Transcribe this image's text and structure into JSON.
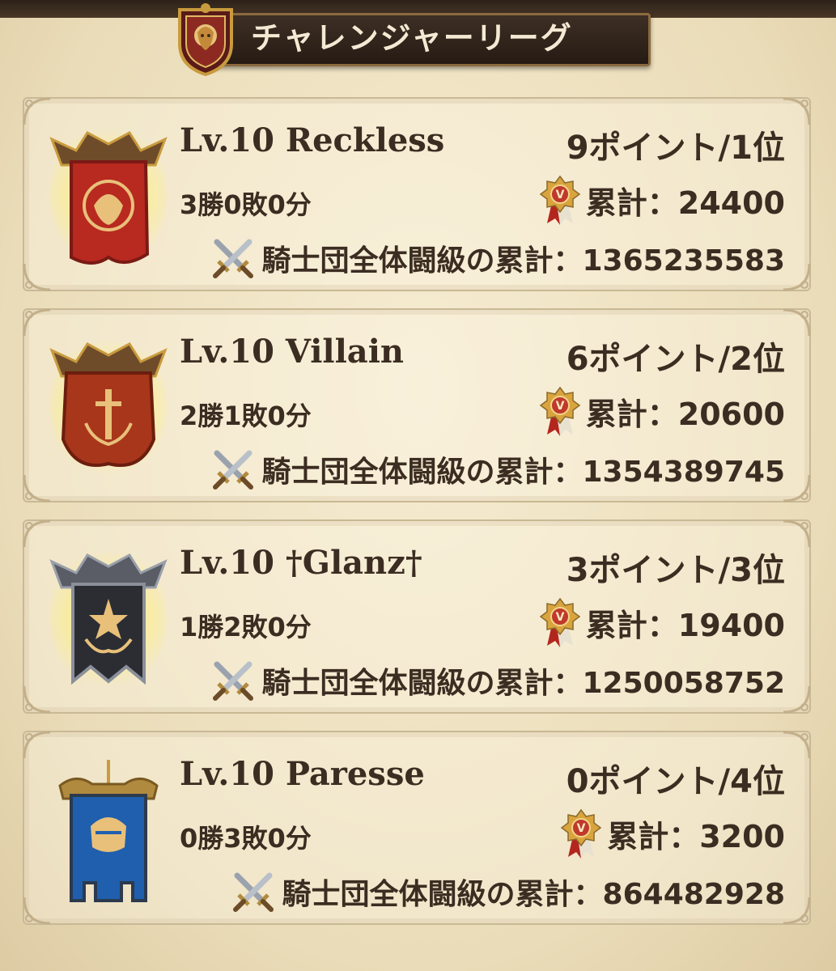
{
  "title": "チャレンジャーリーグ",
  "title_icon": "lion-crest-icon",
  "colors": {
    "parchment": "#efe3c4",
    "title_bar": "#2f231a",
    "text": "#3b2d21",
    "gold": "#c99b3e"
  },
  "teams": [
    {
      "name": "Lv.10 Reckless",
      "points": "9ポイント/1位",
      "record": "3勝0敗0分",
      "cumulative": "累計：24400",
      "guild_total": "騎士団全体闘級の累計：1365235583",
      "emblem": "red-lion-banner-icon",
      "emblem_color": "#b8291f"
    },
    {
      "name": "Lv.10 Villain",
      "points": "6ポイント/2位",
      "record": "2勝1敗0分",
      "cumulative": "累計：20600",
      "guild_total": "騎士団全体闘級の累計：1354389745",
      "emblem": "orange-sword-banner-icon",
      "emblem_color": "#a8361a"
    },
    {
      "name": "Lv.10 †Glanz†",
      "points": "3ポイント/3位",
      "record": "1勝2敗0分",
      "cumulative": "累計：19400",
      "guild_total": "騎士団全体闘級の累計：1250058752",
      "emblem": "black-star-banner-icon",
      "emblem_color": "#2b2d33"
    },
    {
      "name": "Lv.10 Paresse",
      "points": "0ポイント/4位",
      "record": "0勝3敗0分",
      "cumulative": "累計：3200",
      "guild_total": "騎士団全体闘級の累計：864482928",
      "emblem": "blue-helmet-banner-icon",
      "emblem_color": "#1f5fae"
    }
  ]
}
